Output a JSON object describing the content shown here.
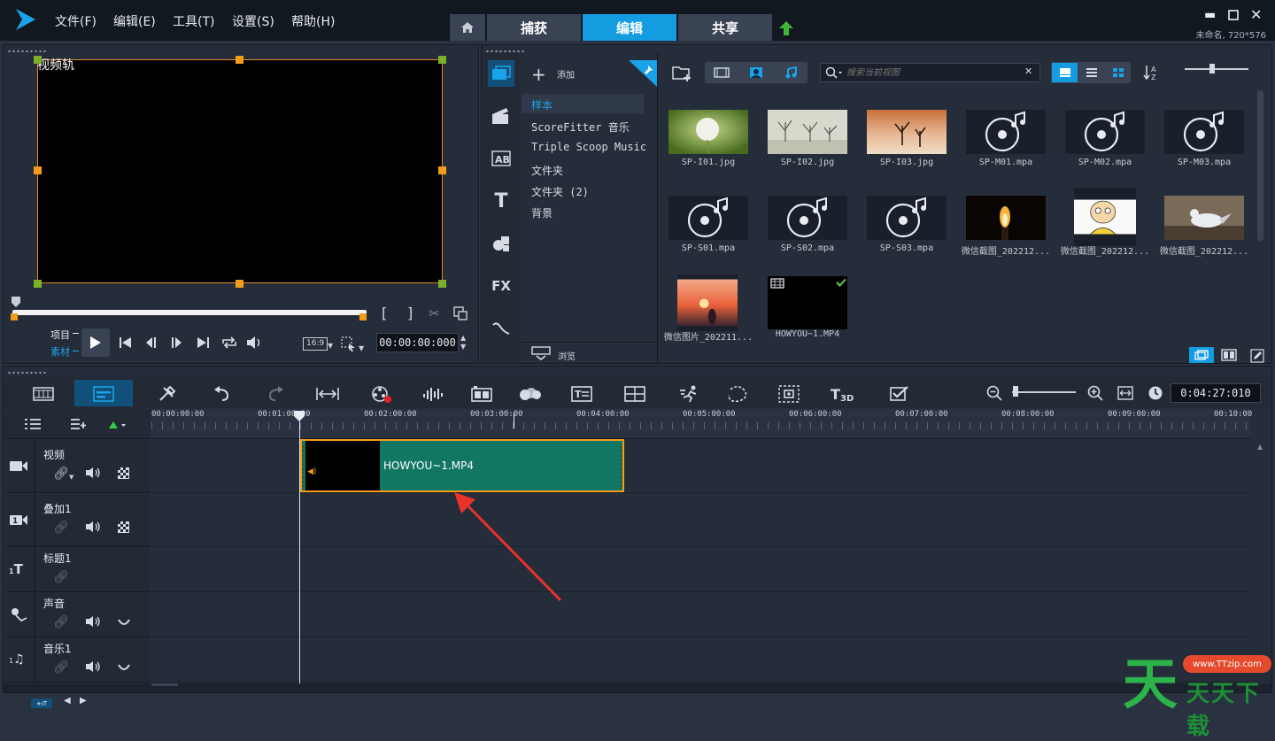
{
  "menu": [
    {
      "label": "文件(F)"
    },
    {
      "label": "编辑(E)"
    },
    {
      "label": "工具(T)"
    },
    {
      "label": "设置(S)"
    },
    {
      "label": "帮助(H)"
    }
  ],
  "tabs": [
    {
      "label": "捕获"
    },
    {
      "label": "编辑"
    },
    {
      "label": "共享"
    }
  ],
  "project_info": "未命名, 720*576",
  "preview": {
    "track_label": "视频轨",
    "mode_project": "项目",
    "mode_clip": "素材",
    "aspect": "16:9",
    "timecode": "00:00:00:000"
  },
  "library": {
    "add_label": "添加",
    "folders": [
      {
        "label": "样本"
      },
      {
        "label": "ScoreFitter 音乐"
      },
      {
        "label": "Triple Scoop Music"
      },
      {
        "label": "文件夹"
      },
      {
        "label": "文件夹 (2)"
      },
      {
        "label": "背景"
      }
    ],
    "browse_label": "浏览",
    "search_placeholder": "搜索当前视图",
    "items": [
      {
        "caption": "SP-I01.jpg",
        "kind": "dandelion"
      },
      {
        "caption": "SP-I02.jpg",
        "kind": "trees"
      },
      {
        "caption": "SP-I03.jpg",
        "kind": "desert"
      },
      {
        "caption": "SP-M01.mpa",
        "kind": "audio"
      },
      {
        "caption": "SP-M02.mpa",
        "kind": "audio"
      },
      {
        "caption": "SP-M03.mpa",
        "kind": "audio"
      },
      {
        "caption": "SP-S01.mpa",
        "kind": "audio"
      },
      {
        "caption": "SP-S02.mpa",
        "kind": "audio"
      },
      {
        "caption": "SP-S03.mpa",
        "kind": "audio"
      },
      {
        "caption": "微信截图_202212...",
        "kind": "candle"
      },
      {
        "caption": "微信截图_202212...",
        "kind": "cartoon"
      },
      {
        "caption": "微信截图_202212...",
        "kind": "bird"
      },
      {
        "caption": "微信图片_202211...",
        "kind": "sunset"
      },
      {
        "caption": "HOWYOU~1.MP4",
        "kind": "video"
      }
    ]
  },
  "timeline": {
    "duration": "0:04:27:010",
    "ruler": [
      "00:00:00:00",
      "00:01:00:00",
      "00:02:00:00",
      "00:03:00:00",
      "00:04:00:00",
      "00:05:00:00",
      "00:06:00:00",
      "00:07:00:00",
      "00:08:00:00",
      "00:09:00:00",
      "00:10:00"
    ],
    "tracks": [
      {
        "name": "视频"
      },
      {
        "name": "叠加1"
      },
      {
        "name": "标题1"
      },
      {
        "name": "声音"
      },
      {
        "name": "音乐1"
      }
    ],
    "clip_label": "HOWYOU~1.MP4"
  },
  "watermark": {
    "url": "www.TTzip.com",
    "text": "天天下载"
  },
  "colors": {
    "accent": "#139ce0",
    "clip": "#117763",
    "selection": "#f39c1a",
    "arrow": "#e8322b"
  }
}
